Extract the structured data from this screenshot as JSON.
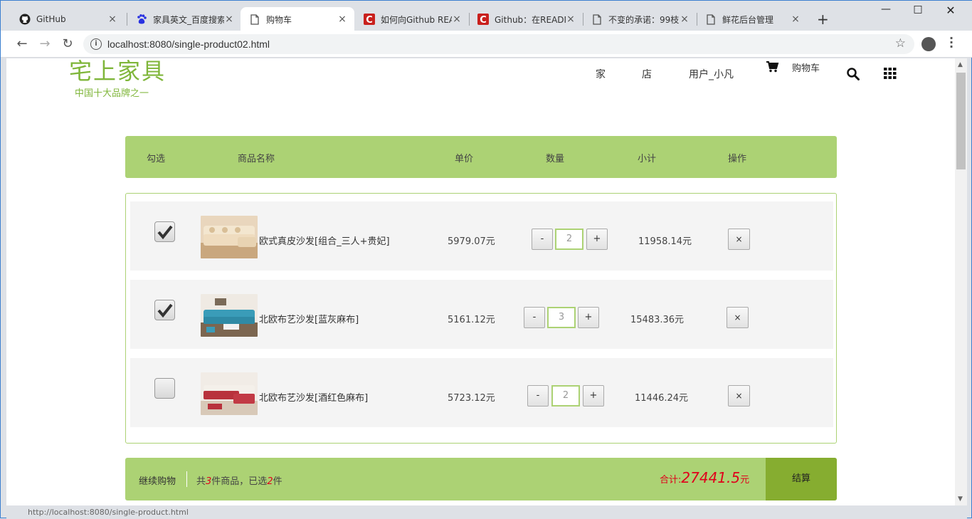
{
  "browser": {
    "tabs": [
      {
        "title": "GitHub",
        "icon": "github-icon",
        "active": false
      },
      {
        "title": "家具英文_百度搜索",
        "icon": "baidu-icon",
        "active": false
      },
      {
        "title": "购物车",
        "icon": "page-icon",
        "active": true
      },
      {
        "title": "如何向Github README",
        "icon": "csdn-icon",
        "active": false
      },
      {
        "title": "Github：在README",
        "icon": "csdn-icon",
        "active": false
      },
      {
        "title": "不变的承诺：99枝",
        "icon": "page-icon",
        "active": false
      },
      {
        "title": "鲜花后台管理",
        "icon": "page-icon",
        "active": false
      }
    ],
    "new_tab": "+",
    "url": "localhost:8080/single-product02.html",
    "status_url": "http://localhost:8080/single-product.html"
  },
  "site": {
    "logo_main": "宅上家具",
    "logo_sub": "中国十大品牌之一",
    "nav": [
      "家",
      "店",
      "用户_小凡"
    ],
    "cart_label": "购物车"
  },
  "cart": {
    "headers": [
      "勾选",
      "商品名称",
      "单价",
      "数量",
      "小计",
      "操作"
    ],
    "items": [
      {
        "checked": true,
        "name": "欧式真皮沙发[组合_三人+贵妃]",
        "price": "5979.07元",
        "qty": "2",
        "subtotal": "11958.14元",
        "minus": "-",
        "plus": "+",
        "delete": "×"
      },
      {
        "checked": true,
        "name": "北欧布艺沙发[蓝灰麻布]",
        "price": "5161.12元",
        "qty": "3",
        "subtotal": "15483.36元",
        "minus": "-",
        "plus": "+",
        "delete": "×"
      },
      {
        "checked": false,
        "name": "北欧布艺沙发[酒红色麻布]",
        "price": "5723.12元",
        "qty": "2",
        "subtotal": "11446.24元",
        "minus": "-",
        "plus": "+",
        "delete": "×"
      }
    ],
    "footer": {
      "continue": "继续购物",
      "count_prefix": "共",
      "total_items": "3",
      "count_mid": "件商品，已选",
      "selected_items": "2",
      "count_suffix": "件",
      "total_label": "合计:",
      "total_value": "27441.5",
      "total_unit": "元",
      "checkout": "结算"
    }
  },
  "colors": {
    "accent": "#acd274",
    "accent_dark": "#86ad30",
    "price_red": "#e0001b",
    "logo_green": "#7fb63a"
  }
}
